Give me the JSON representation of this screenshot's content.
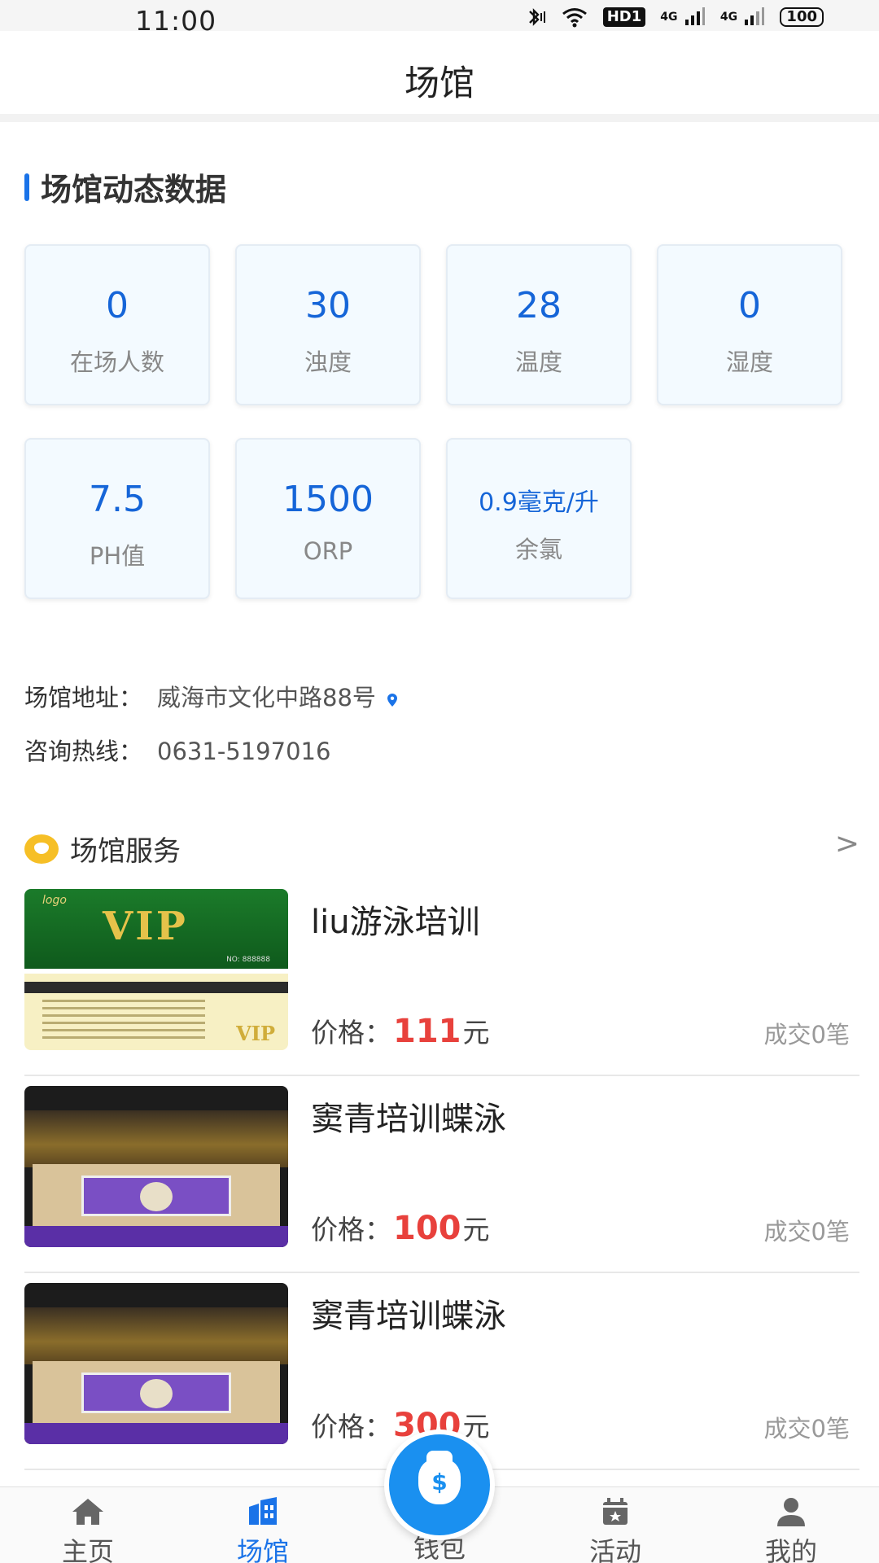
{
  "status_bar": {
    "time": "11:00",
    "hd_label": "HD1",
    "net1": "4G",
    "net2": "4G",
    "battery": "100"
  },
  "header": {
    "title": "场馆"
  },
  "dynamic": {
    "title": "场馆动态数据",
    "cards": [
      {
        "value": "0",
        "label": "在场人数"
      },
      {
        "value": "30",
        "label": "浊度"
      },
      {
        "value": "28",
        "label": "温度"
      },
      {
        "value": "0",
        "label": "湿度"
      },
      {
        "value": "7.5",
        "label": "PH值"
      },
      {
        "value": "1500",
        "label": "ORP"
      },
      {
        "value": "0.9毫克/升",
        "label": "余氯"
      }
    ]
  },
  "info": {
    "address_label": "场馆地址：",
    "address_value": "威海市文化中路88号",
    "hotline_label": "咨询热线：",
    "hotline_value": "0631-5197016"
  },
  "services": {
    "title": "场馆服务",
    "more": ">",
    "price_prefix": "价格：",
    "price_suffix": "元",
    "items": [
      {
        "name": "liu游泳培训",
        "price": "111",
        "deals": "成交0笔",
        "thumb": "vip-card"
      },
      {
        "name": "窦青培训蝶泳",
        "price": "100",
        "deals": "成交0笔",
        "thumb": "arena"
      },
      {
        "name": "窦青培训蝶泳",
        "price": "300",
        "deals": "成交0笔",
        "thumb": "arena"
      }
    ],
    "vip_card": {
      "logo": "logo",
      "vip": "VIP",
      "no": "NO: 888888",
      "vip_small": "VIP"
    }
  },
  "tabbar": {
    "items": [
      {
        "label": "主页",
        "icon": "home-icon"
      },
      {
        "label": "场馆",
        "icon": "venue-icon",
        "active": true
      },
      {
        "label": "钱包",
        "icon": "wallet-icon"
      },
      {
        "label": "活动",
        "icon": "calendar-icon"
      },
      {
        "label": "我的",
        "icon": "user-icon"
      }
    ]
  },
  "colors": {
    "accent": "#1a73e8",
    "price": "#e8413c",
    "card_bg": "#f3faff",
    "wallet": "#1a90f0"
  }
}
